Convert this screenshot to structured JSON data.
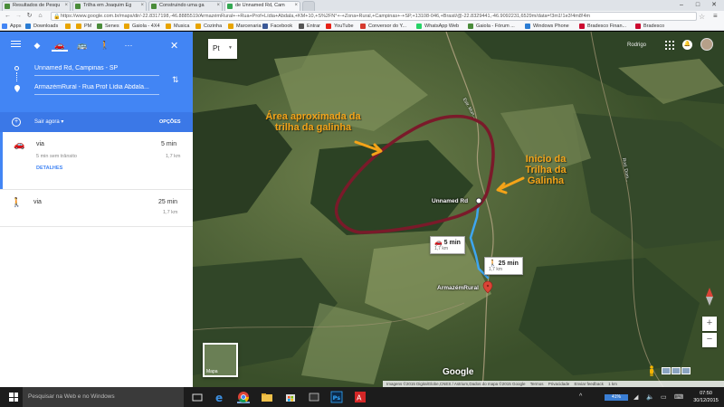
{
  "browser": {
    "tabs": [
      {
        "title": "Resultados de Pesqu",
        "active": false,
        "favicon_color": "#4a8c3a"
      },
      {
        "title": "Trilha em Joaquim Eg",
        "active": false,
        "favicon_color": "#4a8c3a"
      },
      {
        "title": "Construindo uma ga",
        "active": false,
        "favicon_color": "#4a8c3a"
      },
      {
        "title": "de Unnamed Rd, Cam",
        "active": true,
        "favicon_color": "#34a853"
      }
    ],
    "url": "https://www.google.com.br/maps/dir/-22.8317198,-46.8885519/ArmazémRural+-+Rua+Prof+Lídia+Abdala,+KM+10,+S%2FN°+-+Zona+Rural,+Campinas+-+SP,+13108-046,+Brasil/@-22.8329441,-46.9092231,6529m/data=!3m1!1e3!4m8!4m",
    "user_name": "",
    "bookmarks": [
      {
        "label": "Apps",
        "color": "#4285f4"
      },
      {
        "label": "Downloads",
        "color": "#2b7cd3"
      },
      {
        "label": "",
        "color": "#e8a400"
      },
      {
        "label": "PM",
        "color": "#e8a400"
      },
      {
        "label": "Senes",
        "color": "#4a8c3a"
      },
      {
        "label": "Gaiola - 4X4",
        "color": "#e8a400"
      },
      {
        "label": "Musica",
        "color": "#e8a400"
      },
      {
        "label": "Cozinha",
        "color": "#e8a400"
      },
      {
        "label": "Marcenaria",
        "color": "#e8a400"
      },
      {
        "label": "Facebook",
        "color": "#3b5998"
      },
      {
        "label": "Entrar",
        "color": "#555555"
      },
      {
        "label": "YouTube",
        "color": "#e62117"
      },
      {
        "label": "Conversor do Y...",
        "color": "#d63b2f"
      },
      {
        "label": "WhatsApp Web",
        "color": "#25d366"
      },
      {
        "label": "Gaiola - Fórum ...",
        "color": "#4a8c3a"
      },
      {
        "label": "Windows Phone",
        "color": "#2b7cd3"
      },
      {
        "label": "Bradesco Finan...",
        "color": "#cc092f"
      },
      {
        "label": "Bradesco",
        "color": "#cc092f"
      }
    ]
  },
  "directions": {
    "origin": "Unnamed Rd, Campinas - SP",
    "destination": "ArmazémRural - Rua Prof Lídia Abdala...",
    "depart_label": "Sair agora",
    "options_label": "OPÇÕES",
    "routes": [
      {
        "mode_icon": "car-icon",
        "via": "via",
        "duration": "5 min",
        "traffic": "5 min sem trânsito",
        "distance": "1,7 km",
        "details": "DETALHES"
      },
      {
        "mode_icon": "walk-icon",
        "via": "via",
        "duration": "25 min",
        "traffic": "",
        "distance": "1,7 km",
        "details": ""
      }
    ]
  },
  "map": {
    "layer_select": "Pt",
    "user_name": "Rodrigo",
    "annotations": {
      "area": "Área aproximada da trilha da galinha",
      "start": "Inicio da Trilha da Galinha"
    },
    "place_labels": {
      "origin": "Unnamed Rd",
      "destination": "ArmazémRural",
      "road1": "Estr. Mun...",
      "road2": "Rod. Dom..."
    },
    "bubbles": {
      "car_time": "5 min",
      "car_dist": "1,7 km",
      "walk_time": "25 min",
      "walk_dist": "1,7 km"
    },
    "minimap_label": "Mapa",
    "logo": "Google",
    "attribution": [
      "Imagens ©2015 DigitalGlobe,CNES / Astrium,Dados do mapa ©2015 Google",
      "Termos",
      "Privacidade",
      "Enviar feedback",
      "1 km"
    ],
    "colors": {
      "route_drive": "#3ea6f0",
      "annot_arrow": "#f4a318",
      "area_outline": "#7a1a2a"
    }
  },
  "taskbar": {
    "search_placeholder": "Pesquisar na Web e no Windows",
    "battery": "41%",
    "time": "07:50",
    "date": "30/12/2015"
  }
}
